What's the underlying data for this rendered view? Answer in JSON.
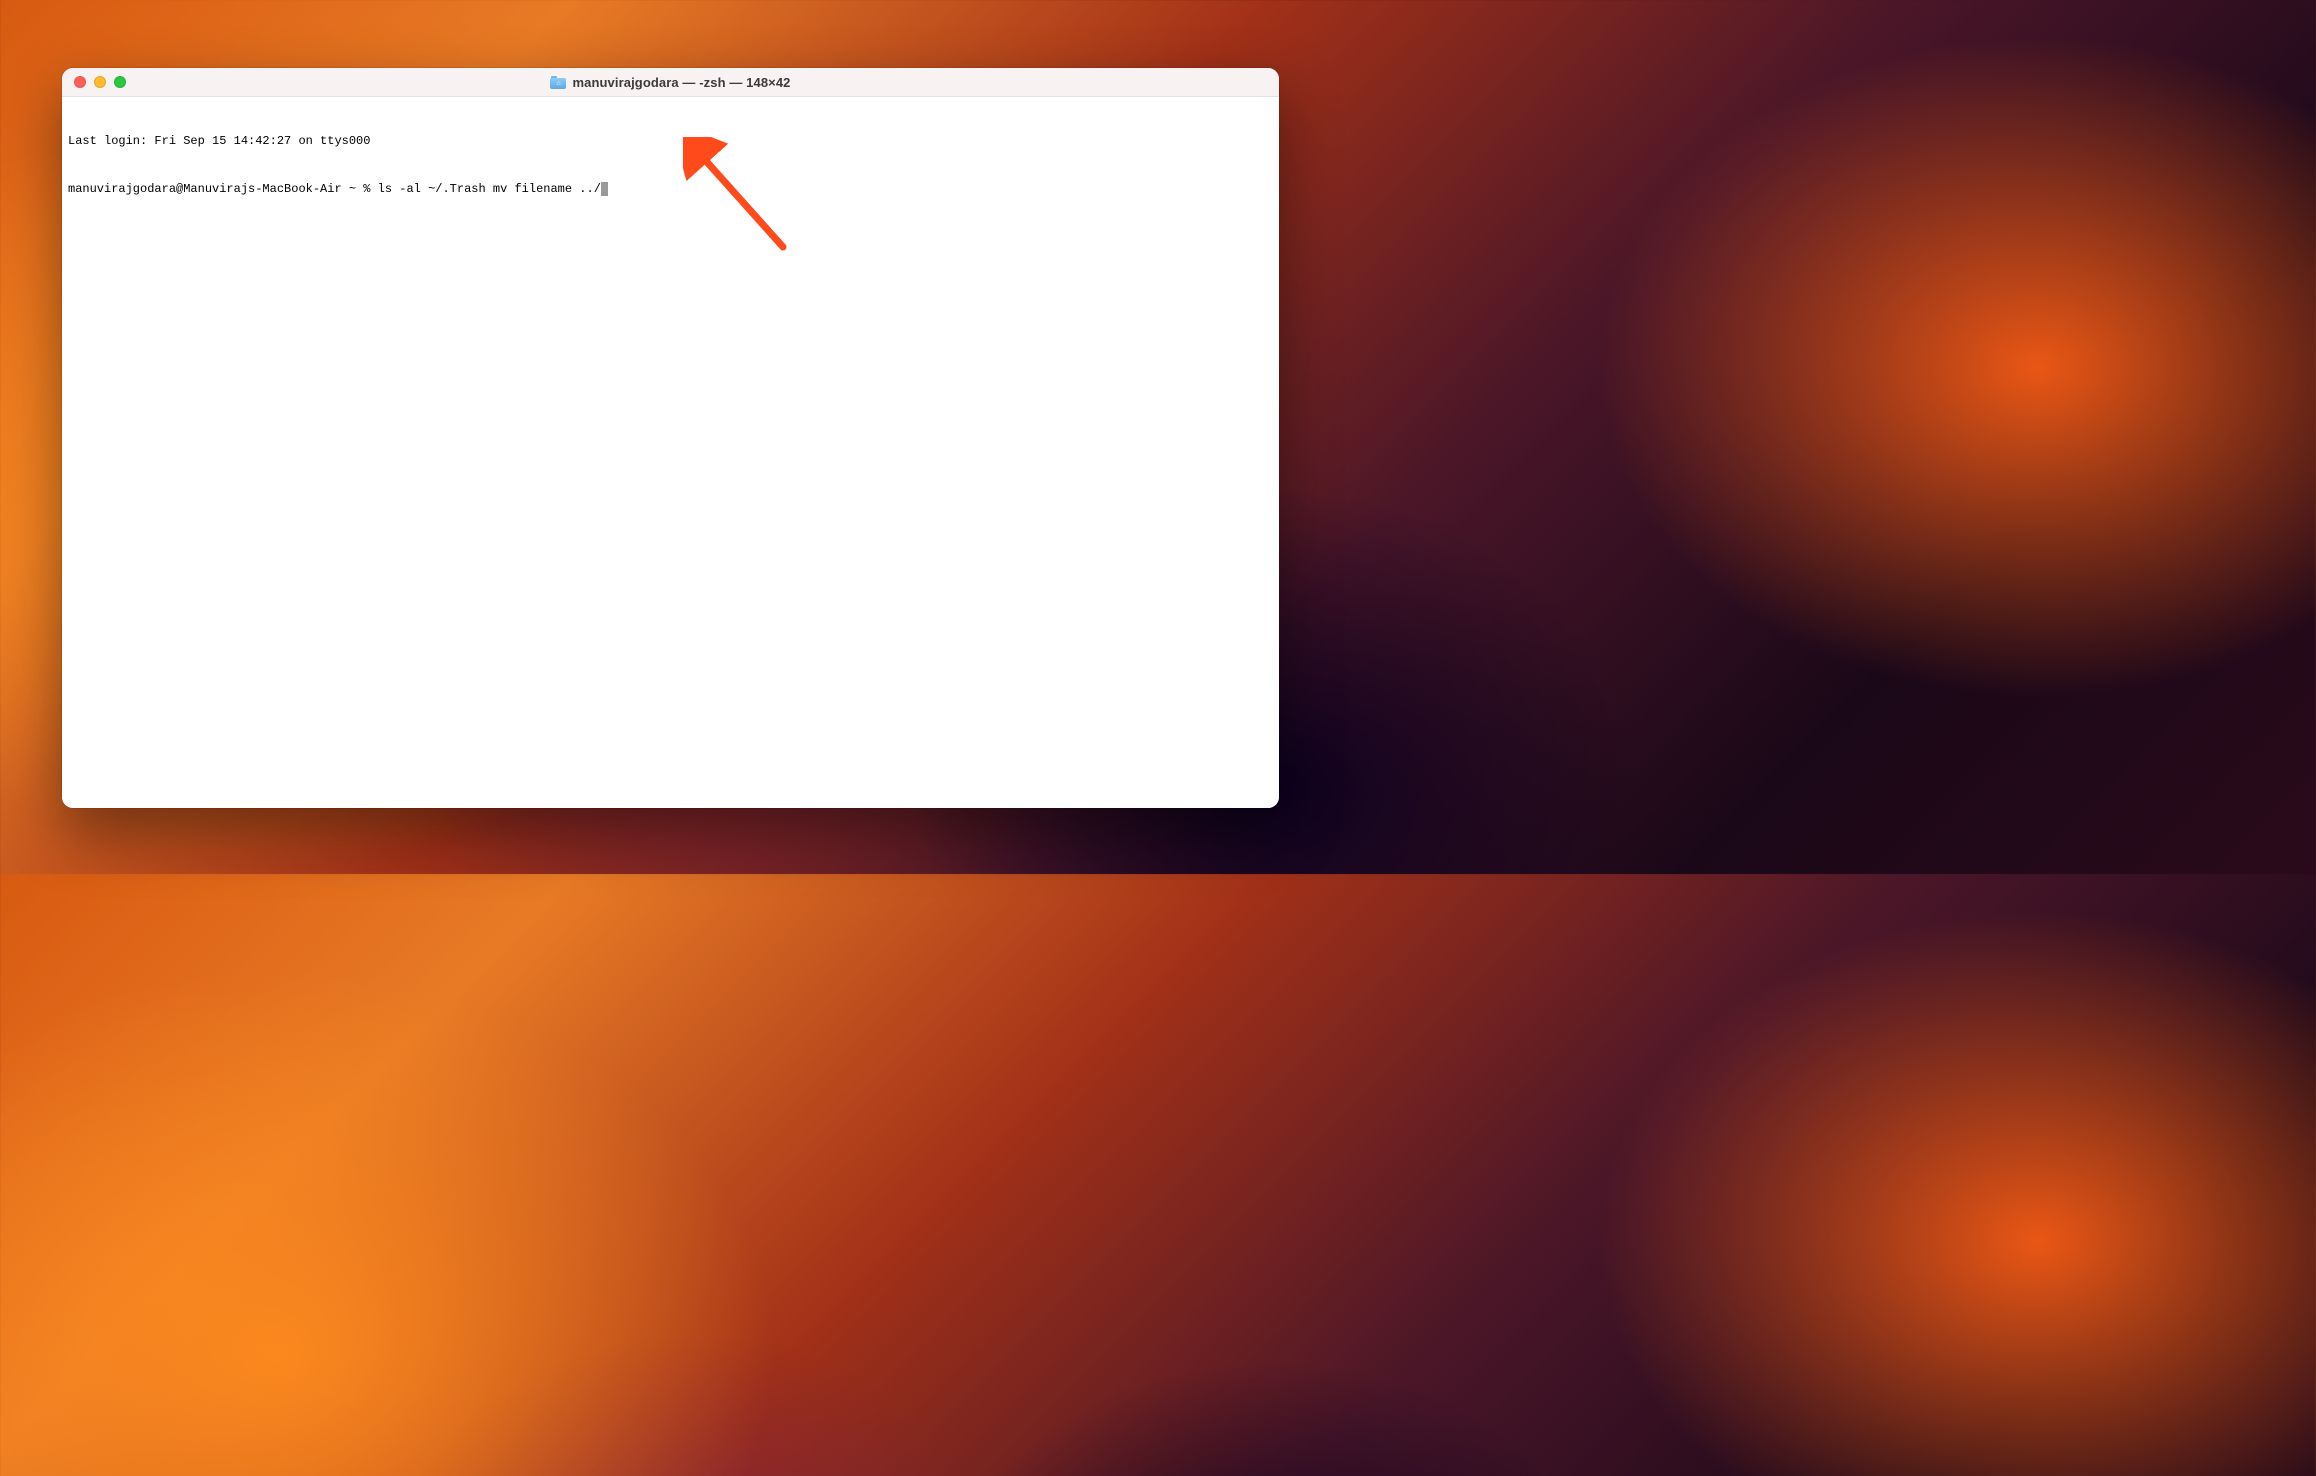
{
  "window": {
    "title": "manuvirajgodara — -zsh — 148×42"
  },
  "terminal": {
    "login_line": "Last login: Fri Sep 15 14:42:27 on ttys000",
    "prompt": "manuvirajgodara@Manuvirajs-MacBook-Air ~ % ",
    "command": "ls -al ~/.Trash mv filename ../"
  },
  "annotation": {
    "color": "#ff4a1c"
  }
}
